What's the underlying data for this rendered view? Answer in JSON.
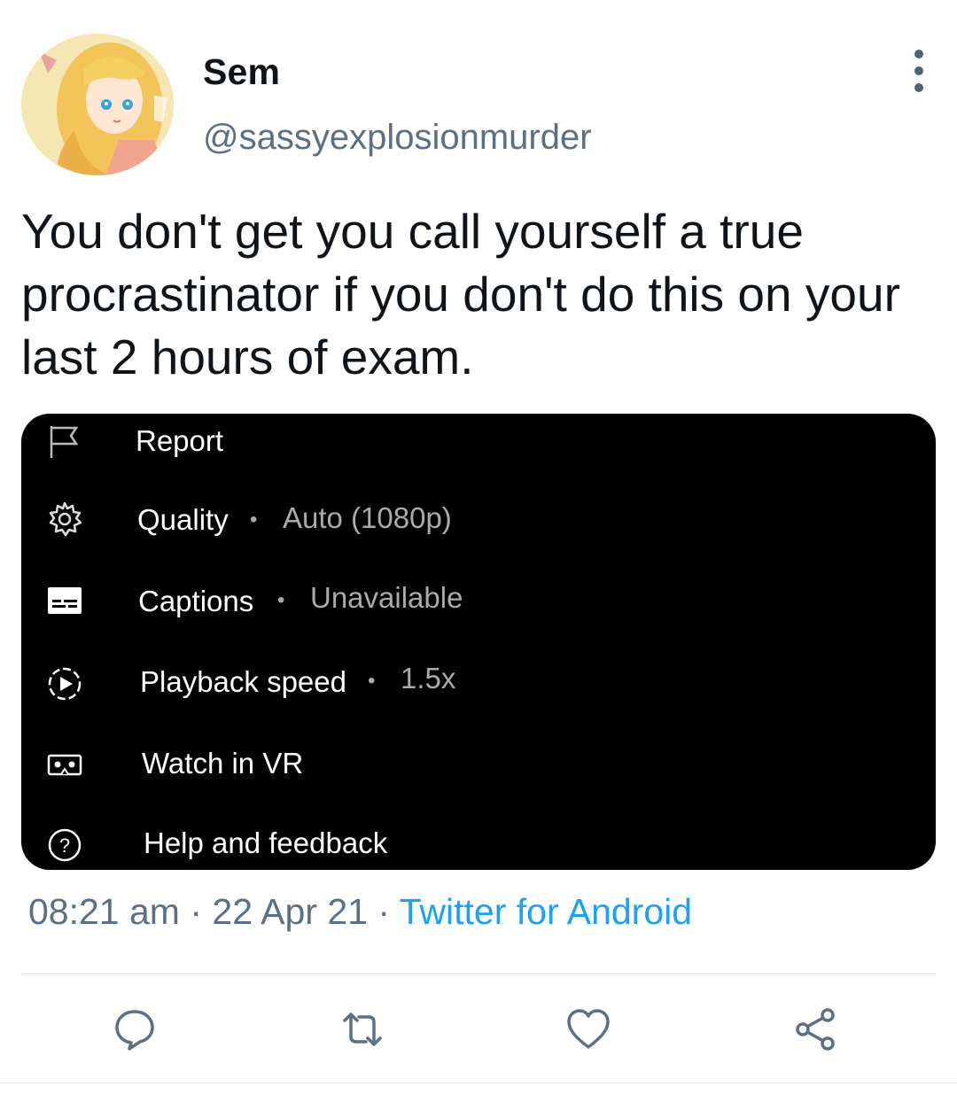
{
  "author": {
    "display_name": "Sem",
    "handle": "@sassyexplosionmurder"
  },
  "tweet": {
    "text": "You don't get you call yourself a true procrastinator if you don't do this on your last 2 hours of exam."
  },
  "media_menu": {
    "items": [
      {
        "icon": "flag-icon",
        "label": "Report",
        "value": ""
      },
      {
        "icon": "gear-icon",
        "label": "Quality",
        "value": "Auto (1080p)"
      },
      {
        "icon": "captions-icon",
        "label": "Captions",
        "value": "Unavailable"
      },
      {
        "icon": "playback-speed-icon",
        "label": "Playback speed",
        "value": "1.5x"
      },
      {
        "icon": "vr-icon",
        "label": "Watch in VR",
        "value": ""
      },
      {
        "icon": "help-icon",
        "label": "Help and feedback",
        "value": ""
      }
    ],
    "separator": "•"
  },
  "meta": {
    "time": "08:21 am",
    "sep1": " · ",
    "date": "22 Apr 21",
    "sep2": " · ",
    "source": "Twitter for Android"
  },
  "actions": [
    "reply-icon",
    "retweet-icon",
    "like-icon",
    "share-icon"
  ],
  "colors": {
    "link": "#1da1f2",
    "secondary_text": "#5b7083",
    "menu_background": "#000000"
  }
}
